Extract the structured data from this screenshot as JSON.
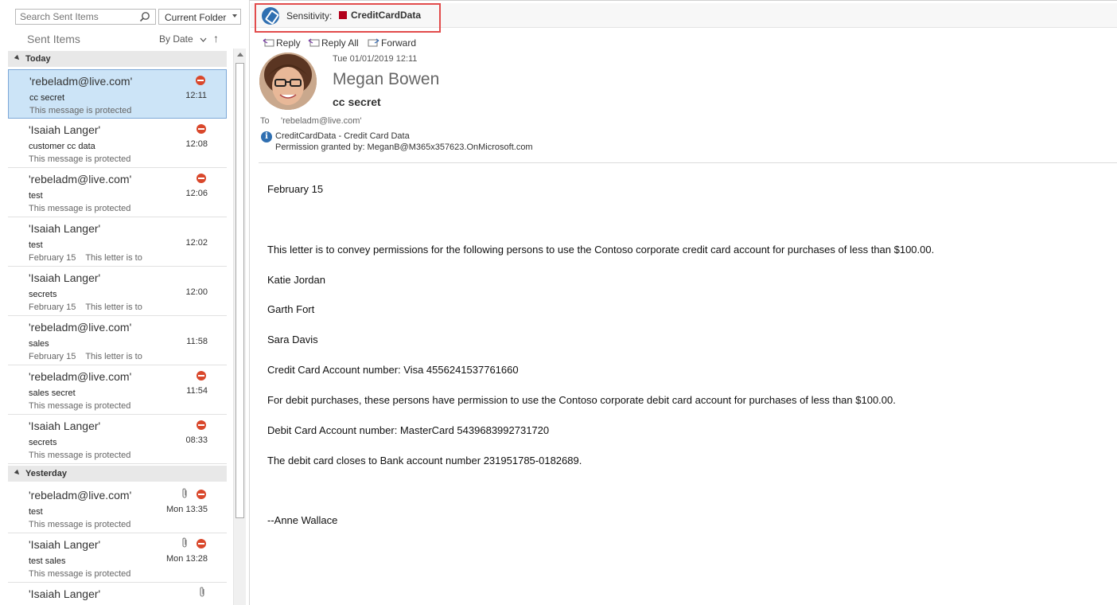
{
  "search": {
    "placeholder": "Search Sent Items",
    "scope": "Current Folder"
  },
  "list_header": {
    "folder": "Sent Items",
    "sort_by": "By Date",
    "sort_direction": "↑"
  },
  "groups": [
    {
      "label": "Today"
    },
    {
      "label": "Yesterday"
    }
  ],
  "messages": [
    {
      "from": "'rebeladm@live.com'",
      "subject": "cc secret",
      "preview": "This message is protected",
      "time": "12:11",
      "protected": true,
      "attachment": false,
      "selected": true
    },
    {
      "from": "'Isaiah Langer'",
      "subject": "customer cc data",
      "preview": "This message is protected",
      "time": "12:08",
      "protected": true,
      "attachment": false
    },
    {
      "from": "'rebeladm@live.com'",
      "subject": "test",
      "preview": "This message is protected",
      "time": "12:06",
      "protected": true,
      "attachment": false
    },
    {
      "from": "'Isaiah Langer'",
      "subject": "test",
      "preview": "February 15    This letter is to",
      "time": "12:02",
      "protected": false,
      "attachment": false
    },
    {
      "from": "'Isaiah Langer'",
      "subject": "secrets",
      "preview": "February 15    This letter is to",
      "time": "12:00",
      "protected": false,
      "attachment": false
    },
    {
      "from": "'rebeladm@live.com'",
      "subject": "sales",
      "preview": "February 15    This letter is to",
      "time": "11:58",
      "protected": false,
      "attachment": false
    },
    {
      "from": "'rebeladm@live.com'",
      "subject": "sales secret",
      "preview": "This message is protected",
      "time": "11:54",
      "protected": true,
      "attachment": false
    },
    {
      "from": "'Isaiah Langer'",
      "subject": "secrets",
      "preview": "This message is protected",
      "time": "08:33",
      "protected": true,
      "attachment": false
    },
    {
      "from": "'rebeladm@live.com'",
      "subject": "test",
      "preview": "This message is protected",
      "time": "Mon 13:35",
      "protected": true,
      "attachment": true
    },
    {
      "from": "'Isaiah Langer'",
      "subject": "test sales",
      "preview": "This message is protected",
      "time": "Mon 13:28",
      "protected": true,
      "attachment": true
    },
    {
      "from": "'Isaiah Langer'",
      "subject": "",
      "preview": "",
      "time": "",
      "protected": false,
      "attachment": true
    }
  ],
  "sensitivity": {
    "label": "Sensitivity:",
    "value": "CreditCardData",
    "color": "#b3001b"
  },
  "actions": {
    "reply": "Reply",
    "reply_all": "Reply All",
    "forward": "Forward"
  },
  "reading": {
    "date": "Tue 01/01/2019 12:11",
    "sender": "Megan Bowen",
    "subject": "cc secret",
    "to_label": "To",
    "to": "'rebeladm@live.com'",
    "permission_title": "CreditCardData - Credit Card Data",
    "permission_granted": "Permission granted by: MeganB@M365x357623.OnMicrosoft.com"
  },
  "body": [
    "February 15",
    "This letter is to convey permissions for the following persons to use the Contoso corporate credit card account for purchases of less than $100.00.",
    "Katie Jordan",
    "Garth Fort",
    "Sara Davis",
    "Credit Card Account number: Visa 4556241537761660",
    "For debit purchases, these persons have permission to use the Contoso corporate debit card account for purchases of less than $100.00.",
    "Debit Card Account number: MasterCard 5439683992731720",
    "The debit card closes to Bank account number 231951785-0182689.",
    "--Anne Wallace"
  ]
}
